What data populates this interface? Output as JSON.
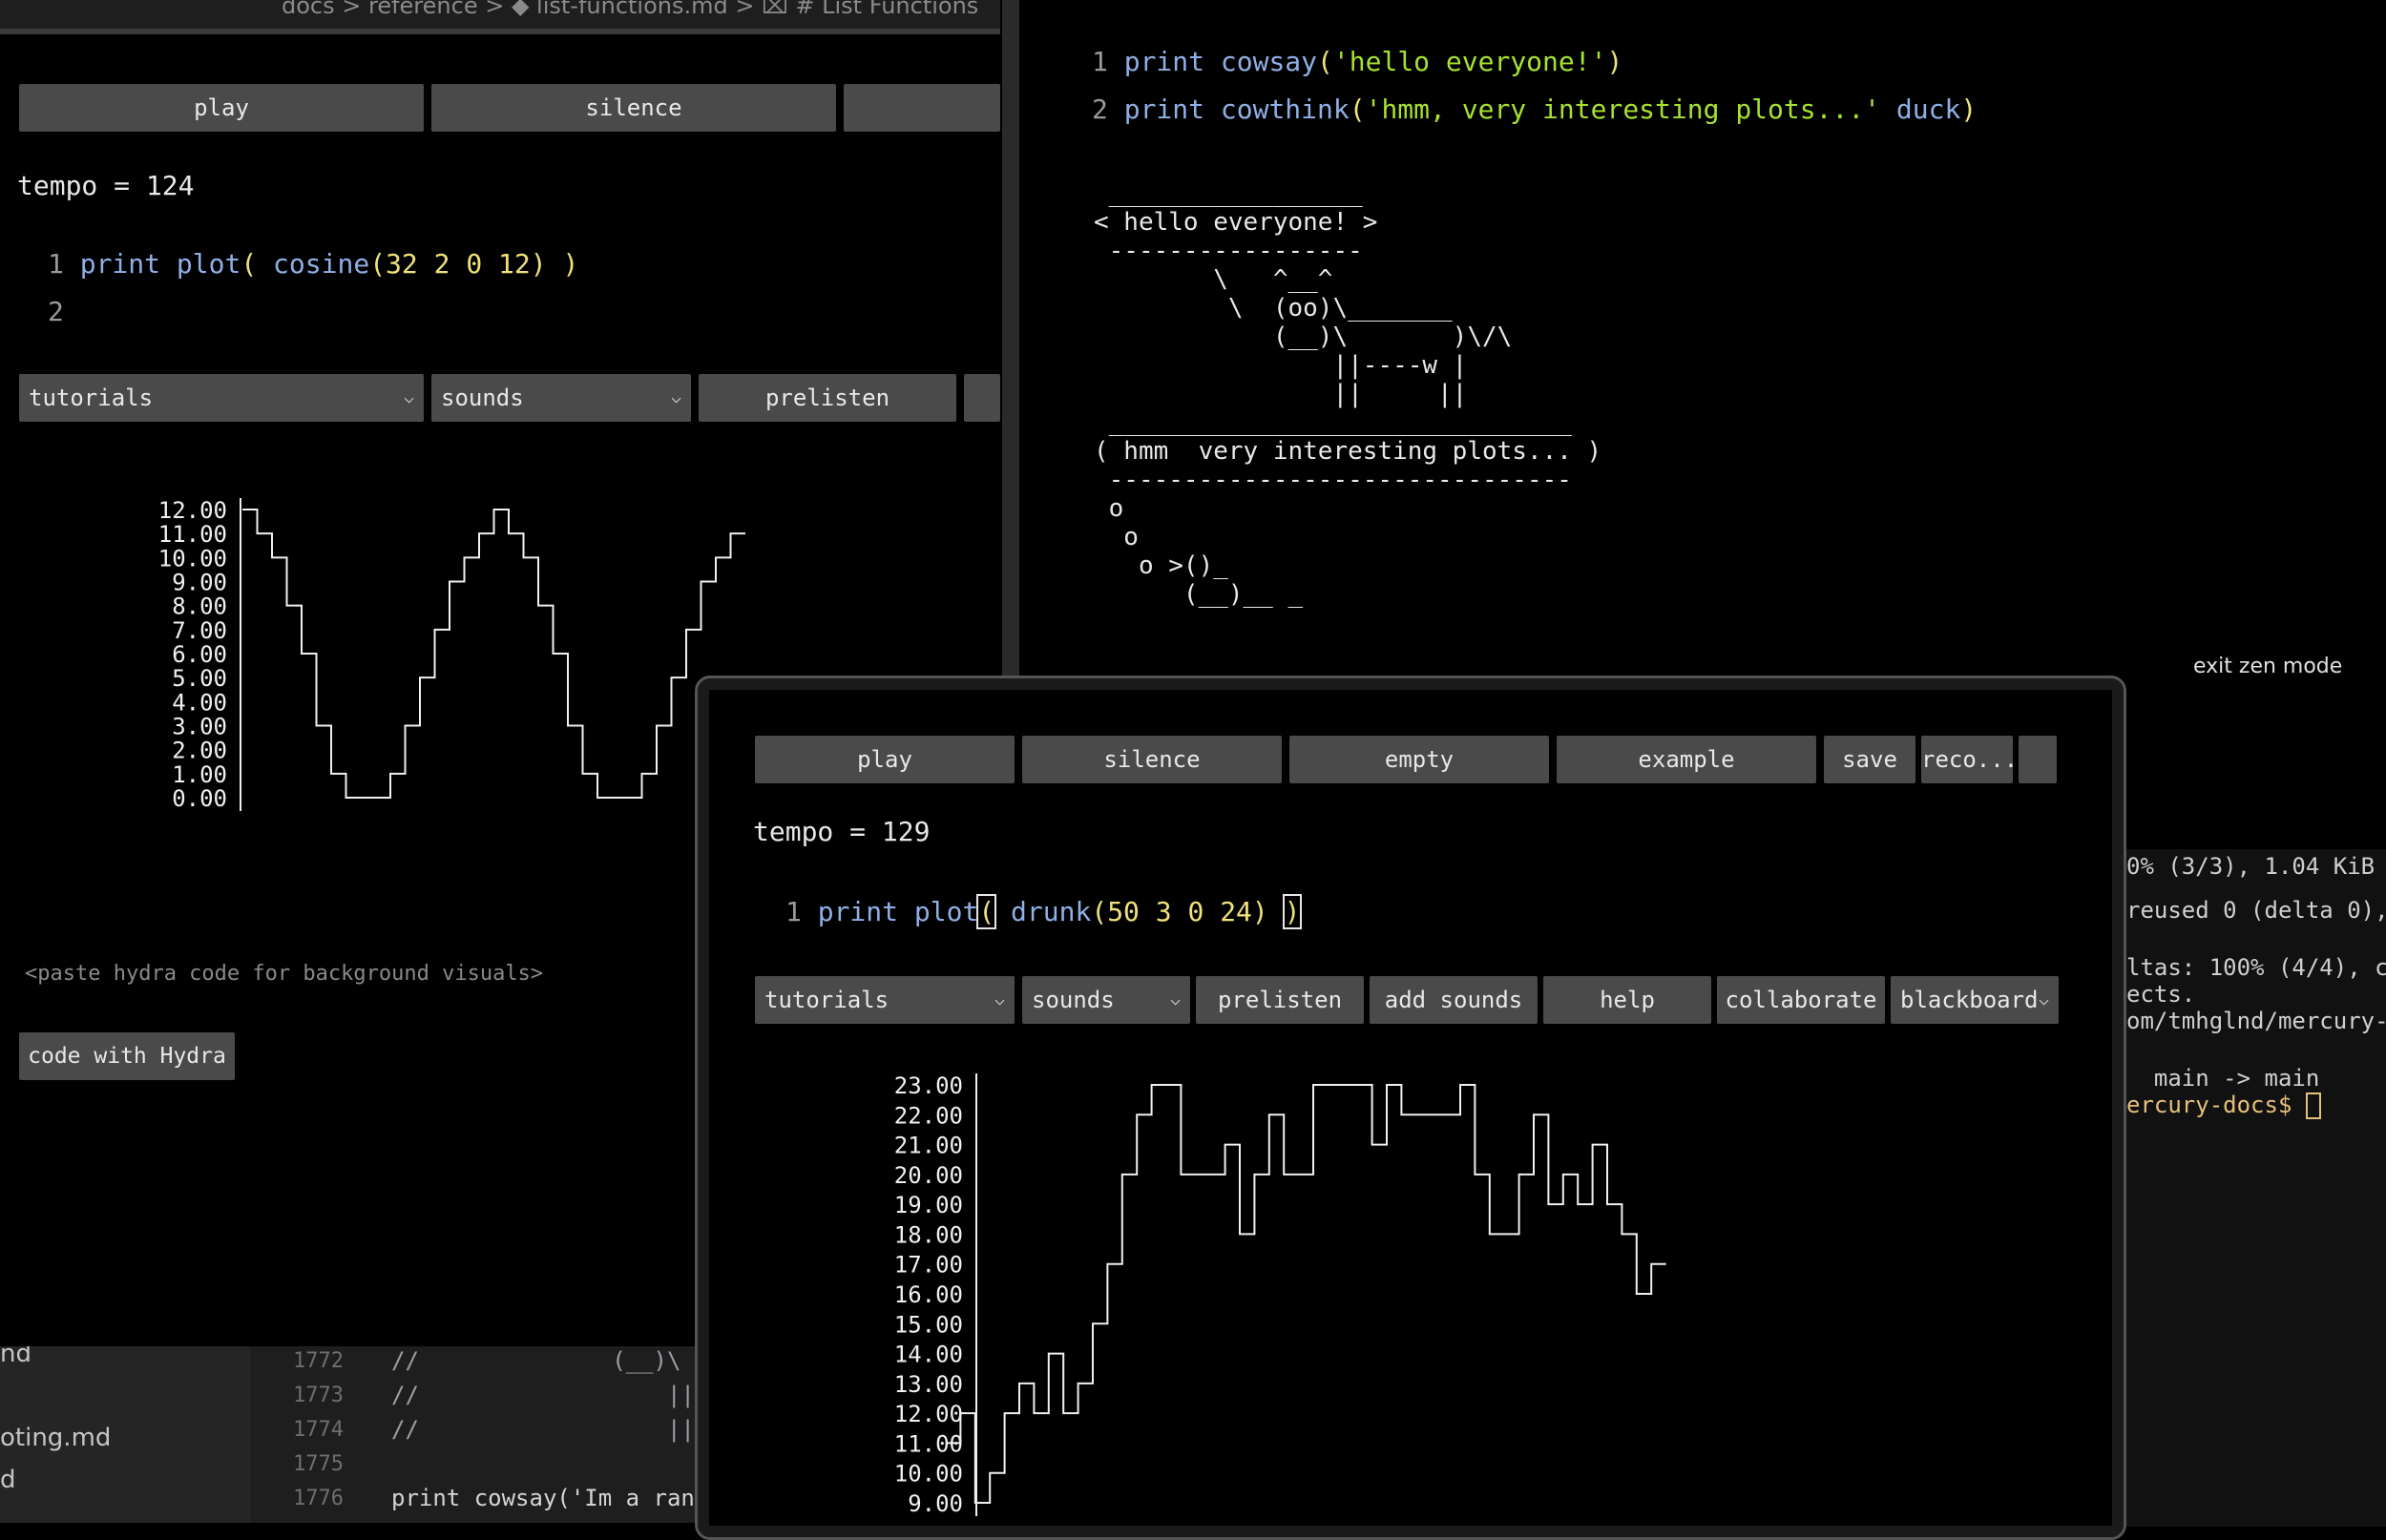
{
  "editor": {
    "breadcrumb": "docs > reference > ◆ list-functions.md > ⌧ # List Functions",
    "sidebar_files": [
      "nd",
      "oting.md",
      "d"
    ],
    "lines": [
      {
        "num": "1772",
        "text": "//              (__)\\"
      },
      {
        "num": "1773",
        "text": "//                  ||-"
      },
      {
        "num": "1774",
        "text": "//                  ||"
      },
      {
        "num": "1775",
        "text": ""
      },
      {
        "num": "1776",
        "text": "print cowsay('Im a ran"
      }
    ]
  },
  "terminal": {
    "lines": [
      "0% (3/3), 1.04 KiB",
      "reused 0 (delta 0),",
      "",
      "ltas: 100% (4/4), c",
      "ects.",
      "om/tmhglnd/mercury-d",
      "",
      "  main -> main",
      "ercury-docs$ "
    ]
  },
  "left_window": {
    "buttons": [
      "play",
      "silence"
    ],
    "tempo": "tempo = 124",
    "code": {
      "line1_num": "1",
      "kw": "print",
      "fn1": "plot",
      "p1": "(",
      "fn2": "cosine",
      "args_open": "(",
      "args": "32 2 0 12",
      "args_close": ")",
      "p2": ")",
      "line2_num": "2"
    },
    "menu": {
      "tutorials": "tutorials",
      "sounds": "sounds",
      "prelisten": "prelisten"
    },
    "hydra_placeholder": "<paste hydra code for background visuals>",
    "hydra_button": "code with Hydra"
  },
  "right_window": {
    "code": [
      {
        "num": "1",
        "kw": "print",
        "fn": "cowsay",
        "open": "(",
        "str": "'hello everyone!'",
        "rest": "",
        "close": ")"
      },
      {
        "num": "2",
        "kw": "print",
        "fn": "cowthink",
        "open": "(",
        "str": "'hmm, very interesting plots...'",
        "rest": " duck",
        "close": ")"
      }
    ],
    "ascii_cow": " _________________\n< hello everyone! >\n -----------------\n        \\   ^__^\n         \\  (oo)\\_______\n            (__)\\       )\\/\\\n                ||----w |\n                ||     ||",
    "ascii_duck": " _______________________________\n( hmm  very interesting plots... )\n -------------------------------\n o\n  o\n   o >()_\n      (__)__ _",
    "exit_zen": "exit zen mode"
  },
  "front_window": {
    "buttons": [
      "play",
      "silence",
      "empty",
      "example",
      "save",
      "reco..."
    ],
    "tempo": "tempo = 129",
    "code": {
      "num": "1",
      "kw": "print",
      "fn1": "plot",
      "p1": "(",
      "fn2": "drunk",
      "args_open": "(",
      "args": "50 3 0 24",
      "args_close": ")",
      "p2": ")"
    },
    "menu": {
      "tutorials": "tutorials",
      "sounds": "sounds",
      "prelisten": "prelisten",
      "add_sounds": "add sounds",
      "help": "help",
      "collaborate": "collaborate",
      "blackboard": "blackboard"
    }
  },
  "chart_data": [
    {
      "type": "line",
      "style": "step",
      "title": "",
      "xlabel": "",
      "ylabel": "",
      "ylim": [
        0,
        12
      ],
      "y_ticks": [
        "12.00",
        "11.00",
        "10.00",
        "9.00",
        "8.00",
        "7.00",
        "6.00",
        "5.00",
        "4.00",
        "3.00",
        "2.00",
        "1.00",
        "0.00"
      ],
      "values": [
        12,
        11,
        10,
        8,
        6,
        3,
        1,
        0,
        0,
        0,
        1,
        3,
        5,
        7,
        9,
        10,
        11,
        12,
        11,
        10,
        8,
        6,
        3,
        1,
        0,
        0,
        0,
        1,
        3,
        5,
        7,
        9,
        10,
        11
      ]
    },
    {
      "type": "line",
      "style": "step",
      "title": "",
      "xlabel": "",
      "ylabel": "",
      "ylim": [
        9,
        23
      ],
      "y_ticks": [
        "23.00",
        "22.00",
        "21.00",
        "20.00",
        "19.00",
        "18.00",
        "17.00",
        "16.00",
        "15.00",
        "14.00",
        "13.00",
        "12.00",
        "11.00",
        "10.00",
        "9.00"
      ],
      "values": [
        11,
        12,
        9,
        10,
        12,
        13,
        12,
        14,
        12,
        13,
        15,
        17,
        20,
        22,
        23,
        23,
        20,
        20,
        20,
        21,
        18,
        20,
        22,
        20,
        20,
        23,
        23,
        23,
        23,
        21,
        23,
        22,
        22,
        22,
        22,
        23,
        20,
        18,
        18,
        20,
        22,
        19,
        20,
        19,
        21,
        19,
        18,
        16,
        17
      ]
    }
  ]
}
